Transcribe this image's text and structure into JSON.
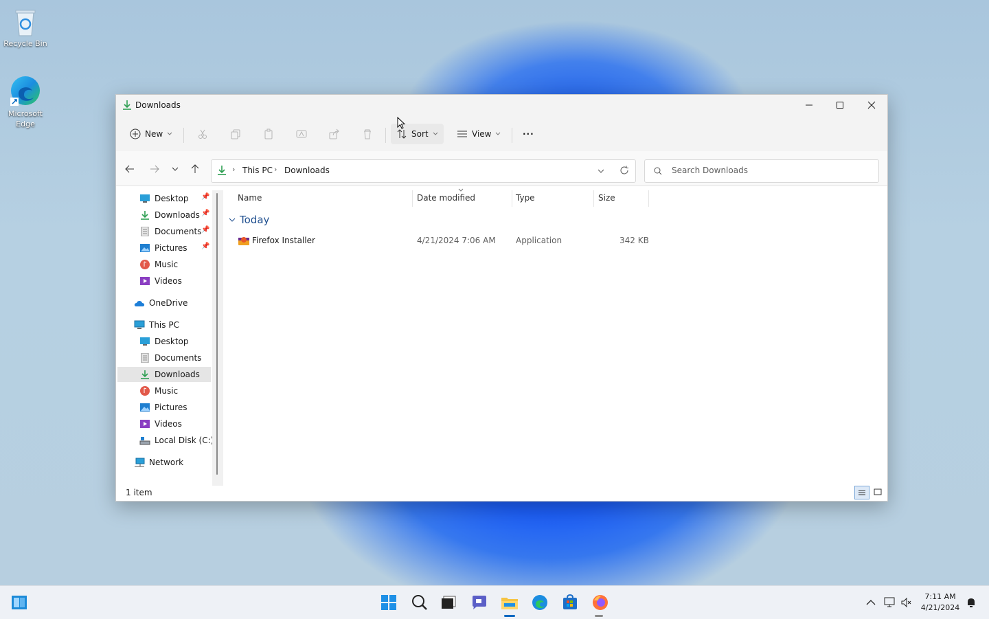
{
  "desktop": {
    "icons": [
      {
        "label": "Recycle Bin",
        "icon": "recycle-bin-icon"
      },
      {
        "label": "Microsoft Edge",
        "icon": "edge-icon"
      }
    ]
  },
  "window": {
    "title": "Downloads",
    "toolbar": {
      "new_label": "New",
      "sort_label": "Sort",
      "view_label": "View",
      "more_label": "···"
    },
    "address": {
      "crumbs": [
        "This PC",
        "Downloads"
      ]
    },
    "search": {
      "placeholder": "Search Downloads"
    },
    "nav": {
      "quick_access": [
        {
          "label": "Desktop",
          "pinned": true,
          "icon": "desktop-folder-icon"
        },
        {
          "label": "Downloads",
          "pinned": true,
          "icon": "downloads-icon"
        },
        {
          "label": "Documents",
          "pinned": true,
          "icon": "documents-icon"
        },
        {
          "label": "Pictures",
          "pinned": true,
          "icon": "pictures-icon"
        },
        {
          "label": "Music",
          "pinned": false,
          "icon": "music-icon"
        },
        {
          "label": "Videos",
          "pinned": false,
          "icon": "videos-icon"
        }
      ],
      "onedrive": "OneDrive",
      "this_pc": "This PC",
      "this_pc_items": [
        {
          "label": "Desktop",
          "icon": "desktop-folder-icon"
        },
        {
          "label": "Documents",
          "icon": "documents-icon"
        },
        {
          "label": "Downloads",
          "icon": "downloads-icon",
          "selected": true
        },
        {
          "label": "Music",
          "icon": "music-icon"
        },
        {
          "label": "Pictures",
          "icon": "pictures-icon"
        },
        {
          "label": "Videos",
          "icon": "videos-icon"
        },
        {
          "label": "Local Disk (C:)",
          "icon": "local-disk-icon"
        }
      ],
      "network": "Network"
    },
    "columns": {
      "name": "Name",
      "date": "Date modified",
      "type": "Type",
      "size": "Size"
    },
    "group": "Today",
    "files": [
      {
        "name": "Firefox Installer",
        "date": "4/21/2024 7:06 AM",
        "type": "Application",
        "size": "342 KB"
      }
    ],
    "status": "1 item"
  },
  "taskbar": {
    "time": "7:11 AM",
    "date": "4/21/2024"
  },
  "colors": {
    "accent": "#0067c0",
    "folder": "#f6c443",
    "selection": "#e5e5e5"
  }
}
